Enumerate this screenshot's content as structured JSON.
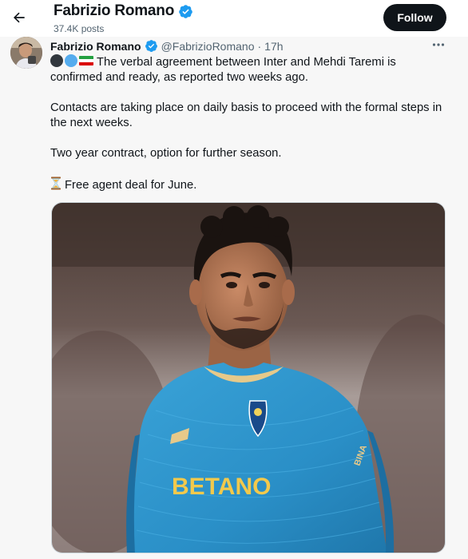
{
  "header": {
    "name": "Fabrizio Romano",
    "post_count": "37.4K posts",
    "follow_label": "Follow"
  },
  "tweet": {
    "author_name": "Fabrizio Romano",
    "handle": "@FabrizioRomano",
    "separator": "·",
    "time": "17h",
    "line1": "The verbal agreement between Inter and Mehdi Taremi is confirmed and ready, as reported two weeks ago.",
    "line2": "Contacts are taking place on daily basis to proceed with the formal steps in the next weeks.",
    "line3": "Two year contract, option for further season.",
    "line4": "Free agent deal for June.",
    "emoji": [
      "black-circle",
      "blue-circle",
      "iran-flag",
      "hourglass"
    ],
    "media": {
      "jersey_sponsor": "BETANO",
      "jersey_brand": "BINA",
      "colors": {
        "jersey": "#2a8fc7",
        "crest": "#1a4a8a"
      }
    }
  },
  "colors": {
    "verified": "#1d9bf0",
    "follow_bg": "#0f1419"
  }
}
